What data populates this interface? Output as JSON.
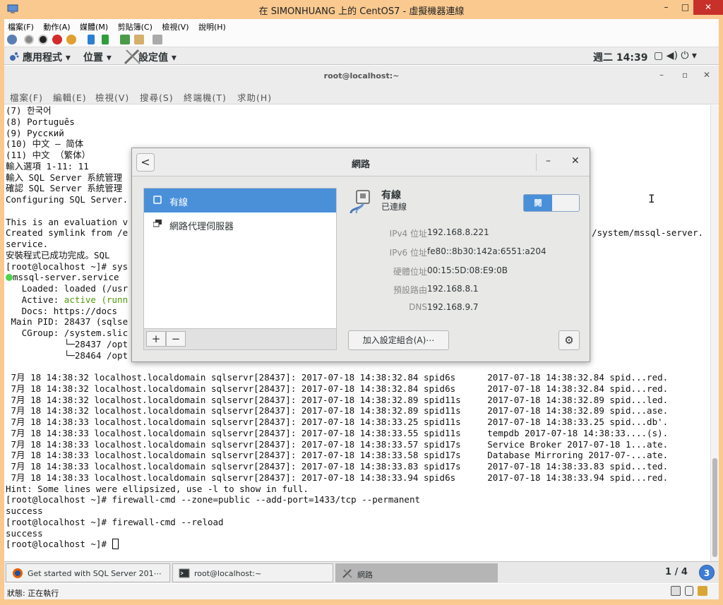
{
  "host": {
    "title": "在 SIMONHUANG 上的 CentOS7 - 虛擬機器連線",
    "min": "–",
    "max": "□",
    "close": "✕",
    "menu": [
      "檔案(F)",
      "動作(A)",
      "媒體(M)",
      "剪貼簿(C)",
      "檢視(V)",
      "說明(H)"
    ],
    "status": "狀態: 正在執行"
  },
  "gnome": {
    "apps": "應用程式 ▾",
    "places": "位置 ▾",
    "settings": "設定值 ▾",
    "clock": "週二 14:39",
    "tray": "▢  ◀)  ⏻ ▾"
  },
  "terminal": {
    "title": "root@localhost:~",
    "min": "–",
    "max": "▫",
    "close": "✕",
    "menu": [
      "檔案(F)",
      "編輯(E)",
      "檢視(V)",
      "搜尋(S)",
      "終端機(T)",
      "求助(H)"
    ],
    "lines": [
      "(7) 한국어",
      "(8) Português",
      "(9) Русский",
      "(10) 中文 — 简体",
      "(11) 中文 （繁体）",
      "輸入選項 1-11: 11",
      "輸入 SQL Server 系統管理",
      "確認 SQL Server 系統管理",
      "Configuring SQL Server.",
      "",
      "This is an evaluation v",
      "Created symlink from /e",
      "service.",
      "安裝程式已成功完成。SQL",
      "[root@localhost ~]# sys"
    ],
    "right_fragment": "/system/mssql-server.",
    "service_line": "mssql-server.service",
    "status_lines": [
      "   Loaded: loaded (/usr",
      "   Docs: https://docs",
      " Main PID: 28437 (sqlse",
      "   CGroup: /system.slic",
      "           └─28437 /opt",
      "           └─28464 /opt"
    ],
    "active_prefix": "   Active: ",
    "active_value": "active (runn",
    "log_lines": [
      " 7月 18 14:38:32 localhost.localdomain sqlservr[28437]: 2017-07-18 14:38:32.84 spid6s      2017-07-18 14:38:32.84 spid...red.",
      " 7月 18 14:38:32 localhost.localdomain sqlservr[28437]: 2017-07-18 14:38:32.84 spid6s      2017-07-18 14:38:32.84 spid...red.",
      " 7月 18 14:38:32 localhost.localdomain sqlservr[28437]: 2017-07-18 14:38:32.89 spid11s     2017-07-18 14:38:32.89 spid...led.",
      " 7月 18 14:38:32 localhost.localdomain sqlservr[28437]: 2017-07-18 14:38:32.89 spid11s     2017-07-18 14:38:32.89 spid...ase.",
      " 7月 18 14:38:33 localhost.localdomain sqlservr[28437]: 2017-07-18 14:38:33.25 spid11s     2017-07-18 14:38:33.25 spid...db'.",
      " 7月 18 14:38:33 localhost.localdomain sqlservr[28437]: 2017-07-18 14:38:33.55 spid11s     tempdb 2017-07-18 14:38:33....(s).",
      " 7月 18 14:38:33 localhost.localdomain sqlservr[28437]: 2017-07-18 14:38:33.57 spid17s     Service Broker 2017-07-18 1...ate.",
      " 7月 18 14:38:33 localhost.localdomain sqlservr[28437]: 2017-07-18 14:38:33.58 spid17s     Database Mirroring 2017-07-...ate.",
      " 7月 18 14:38:33 localhost.localdomain sqlservr[28437]: 2017-07-18 14:38:33.83 spid17s     2017-07-18 14:38:33.83 spid...ted.",
      " 7月 18 14:38:33 localhost.localdomain sqlservr[28437]: 2017-07-18 14:38:33.94 spid6s      2017-07-18 14:38:33.94 spid...red."
    ],
    "tail_lines": [
      "Hint: Some lines were ellipsized, use -l to show in full.",
      "[root@localhost ~]# firewall-cmd --zone=public --add-port=1433/tcp --permanent",
      "success",
      "[root@localhost ~]# firewall-cmd --reload",
      "success"
    ],
    "prompt": "[root@localhost ~]# "
  },
  "network": {
    "title": "網路",
    "back": "<",
    "min": "–",
    "close": "✕",
    "items": [
      {
        "label": "有線"
      },
      {
        "label": "網路代理伺服器"
      }
    ],
    "add": "+",
    "remove": "−",
    "device_name": "有線",
    "device_status": "已連線",
    "toggle_label": "開",
    "toggle_on": true,
    "details": [
      {
        "key": "IPv4 位址",
        "value": "192.168.8.221"
      },
      {
        "key": "IPv6 位址",
        "value": "fe80::8b30:142a:6551:a204"
      },
      {
        "key": "硬體位址",
        "value": "00:15:5D:08:E9:0B"
      },
      {
        "key": "預設路由",
        "value": "192.168.8.1"
      },
      {
        "key": "DNS",
        "value": "192.168.9.7"
      }
    ],
    "add_profile": "加入設定組合(A)⋯",
    "gear": "⚙"
  },
  "taskbar": {
    "items": [
      {
        "label": "Get started with SQL Server 201⋯"
      },
      {
        "label": "root@localhost:~"
      },
      {
        "label": "網路"
      }
    ],
    "workspace": "1 / 4",
    "workspace_badge": "3"
  }
}
